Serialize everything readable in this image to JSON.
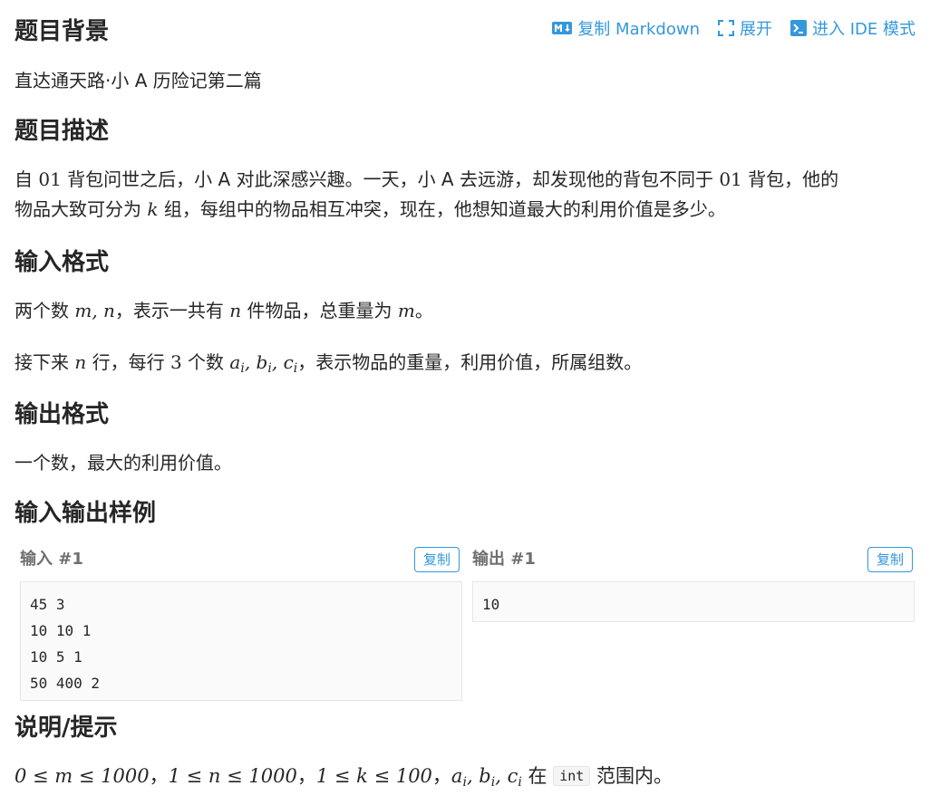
{
  "toolbar": {
    "copy_markdown": "复制 Markdown",
    "expand": "展开",
    "ide_mode": "进入 IDE 模式",
    "accent": "#3498db"
  },
  "sections": {
    "background_title": "题目背景",
    "background_text": "直达通天路·小 A 历险记第二篇",
    "description_title": "题目描述",
    "description_line1_a": "自 ",
    "description_line1_num": "01",
    "description_line1_b": " 背包问世之后，小 A 对此深感兴趣。一天，小 A 去远游，却发现他的背包不同于 ",
    "description_line1_num2": "01",
    "description_line1_c": " 背包，他的",
    "description_line2_a": "物品大致可分为 ",
    "description_line2_var": "k",
    "description_line2_b": " 组，每组中的物品相互冲突，现在，他想知道最大的利用价值是多少。",
    "input_title": "输入格式",
    "input_line1_a": "两个数 ",
    "input_line1_math": "m, n",
    "input_line1_b": "，表示一共有 ",
    "input_line1_var": "n",
    "input_line1_c": " 件物品，总重量为 ",
    "input_line1_var2": "m",
    "input_line1_d": "。",
    "input_line2_a": "接下来 ",
    "input_line2_var": "n",
    "input_line2_b": " 行，每行 ",
    "input_line2_num": "3",
    "input_line2_c": " 个数 ",
    "input_line2_d": "，表示物品的重量，利用价值，所属组数。",
    "output_title": "输出格式",
    "output_text": "一个数，最大的利用价值。",
    "samples_title": "输入输出样例",
    "hint_title": "说明/提示",
    "hint_math1": "0 ≤ m ≤ 1000",
    "hint_math2": "1 ≤ n ≤ 1000",
    "hint_math3": "1 ≤ k ≤ 100",
    "hint_sep": "，",
    "hint_in": " 在 ",
    "hint_code": "int",
    "hint_tail": " 范围内。"
  },
  "samples": {
    "input_label": "输入 #1",
    "output_label": "输出 #1",
    "copy_label": "复制",
    "input_lines": [
      "45 3",
      "10 10 1",
      "10 5 1",
      "50 400 2"
    ],
    "output_lines": [
      "10"
    ]
  }
}
